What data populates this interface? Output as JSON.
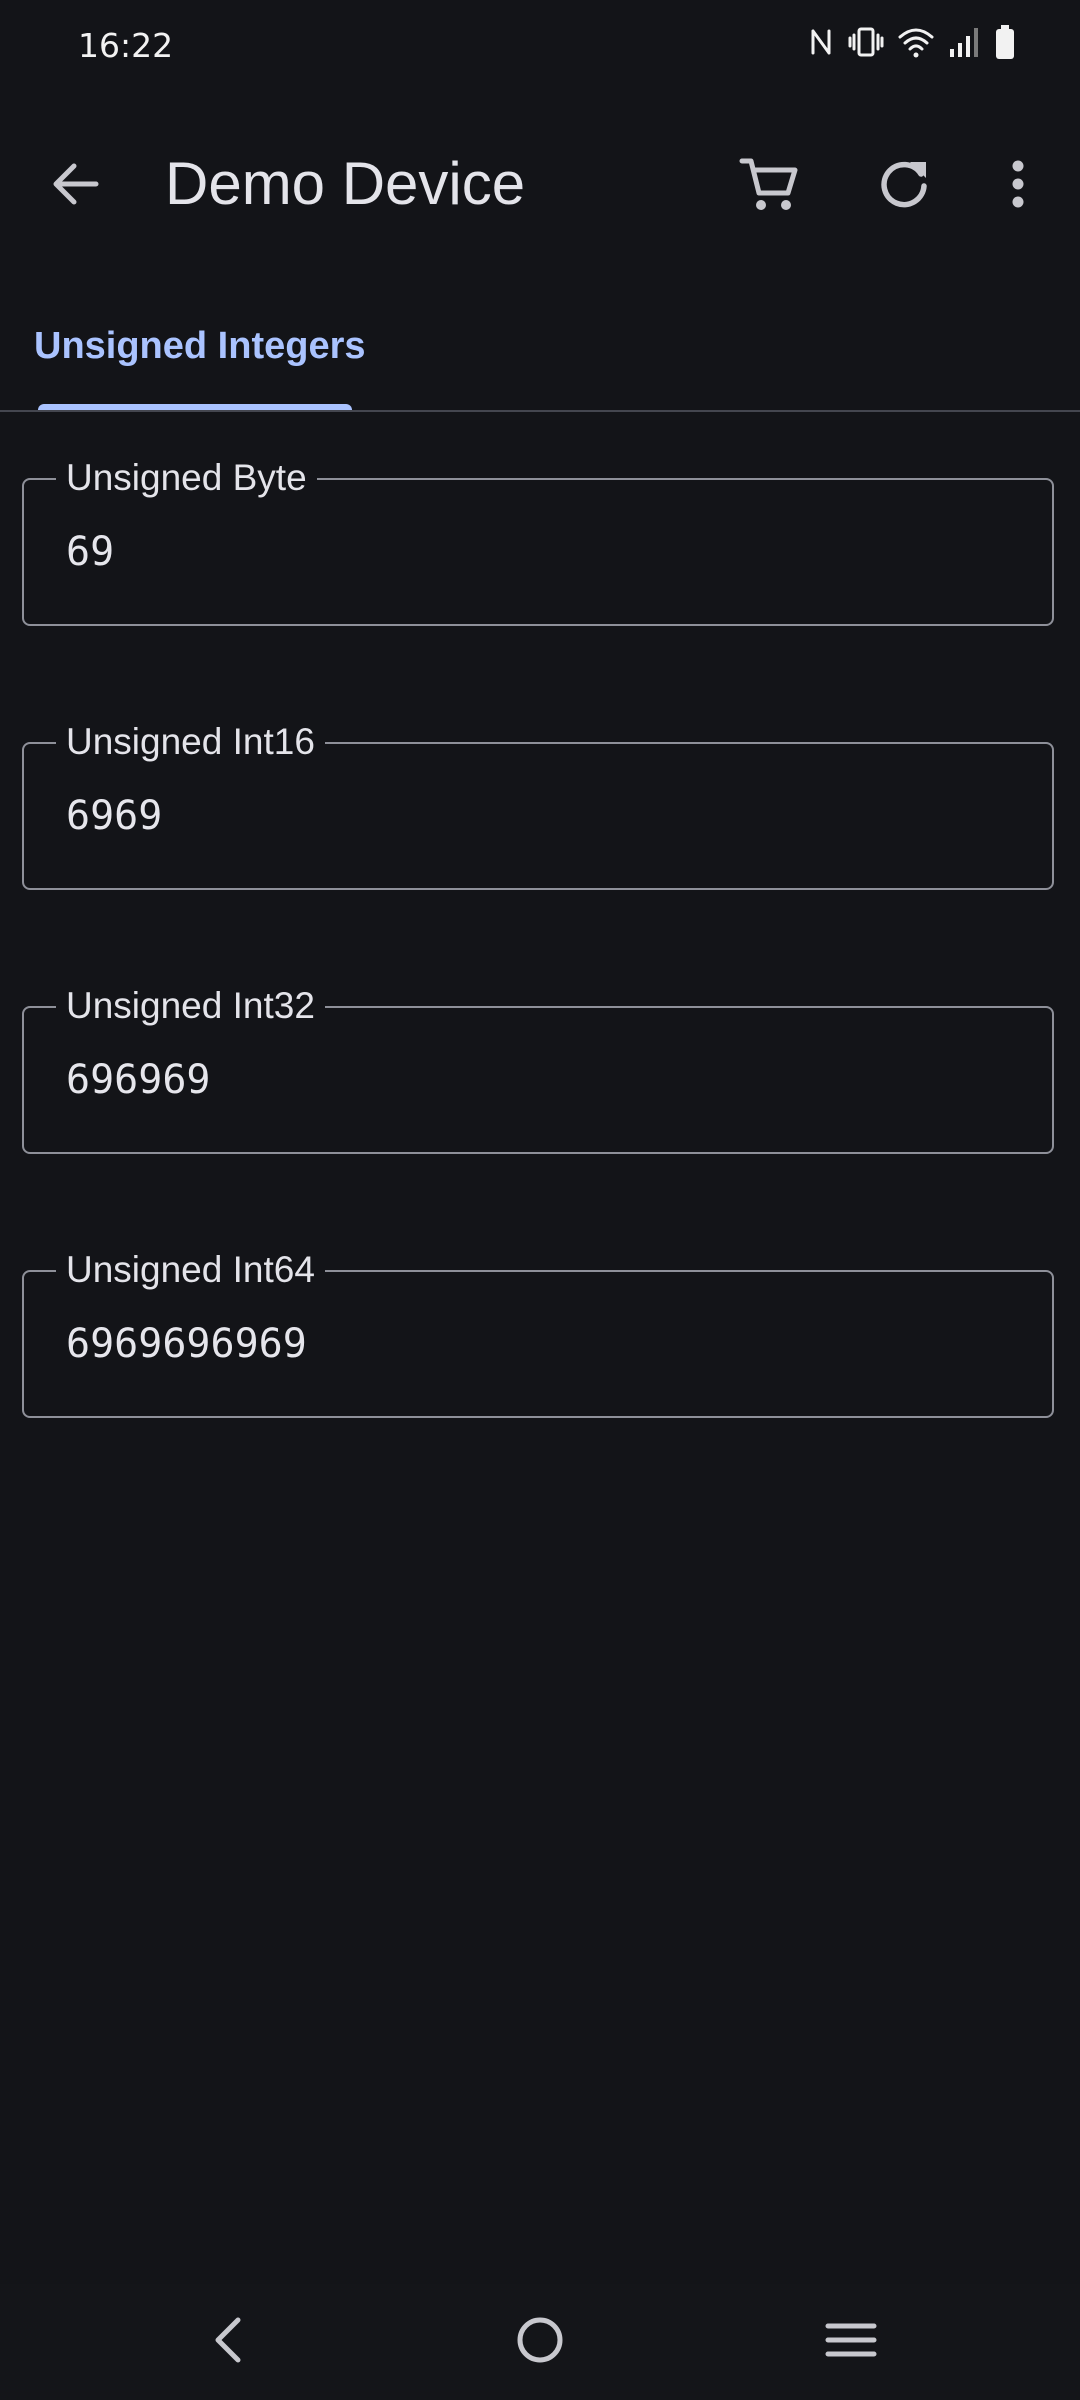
{
  "status_bar": {
    "time": "16:22",
    "icons": [
      "nfc-icon",
      "vibrate-icon",
      "wifi-icon",
      "signal-icon",
      "battery-icon"
    ]
  },
  "app_bar": {
    "title": "Demo Device",
    "actions": [
      "back-icon",
      "cart-icon",
      "refresh-icon",
      "more-vert-icon"
    ]
  },
  "tabs": [
    {
      "label": "Unsigned Integers",
      "selected": true
    }
  ],
  "fields": [
    {
      "label": "Unsigned Byte",
      "value": "69"
    },
    {
      "label": "Unsigned Int16",
      "value": "6969"
    },
    {
      "label": "Unsigned Int32",
      "value": "696969"
    },
    {
      "label": "Unsigned Int64",
      "value": "6969696969"
    }
  ],
  "nav_bar": {
    "buttons": [
      "nav-back-icon",
      "nav-home-icon",
      "nav-recents-icon"
    ]
  },
  "colors": {
    "background": "#131418",
    "accent": "#aac3ff",
    "outline": "#8e9099",
    "text": "#e4e4ea"
  }
}
